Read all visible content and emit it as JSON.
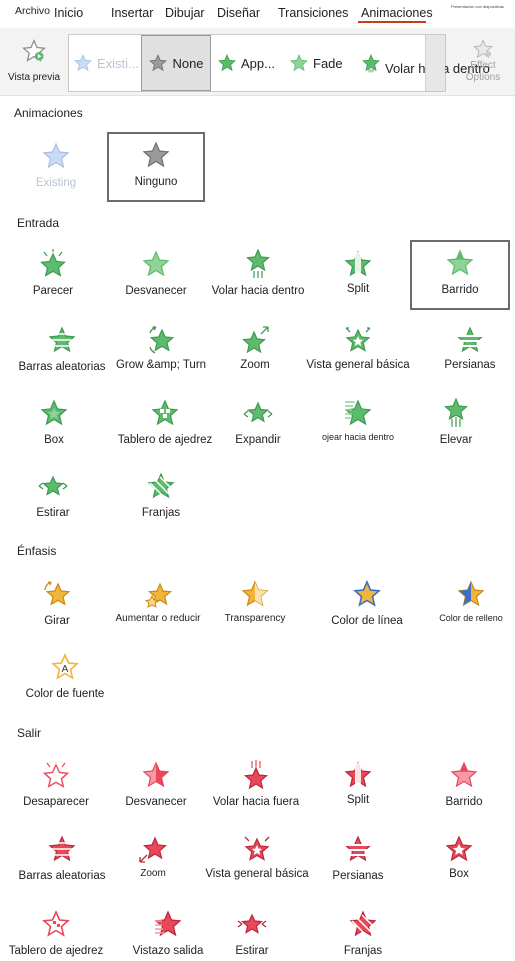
{
  "tabs": {
    "archivo": "Archivo",
    "inicio": "Inicio",
    "insertar": "Insertar",
    "dibujar": "Dibujar",
    "disenar": "Diseñar",
    "transiciones": "Transiciones",
    "animaciones": "Animaciones",
    "presentacion": "Presentación con diapositivas"
  },
  "ribbon": {
    "preview_label": "Vista previa",
    "gallery": [
      {
        "label": "Existi..."
      },
      {
        "label": "None"
      },
      {
        "label": "App..."
      },
      {
        "label": "Fade"
      },
      {
        "label": "Volar hacia dentro"
      }
    ],
    "effect_options_line1": "Effect",
    "effect_options_line2": "Options"
  },
  "sections": {
    "animaciones": {
      "title": "Animaciones",
      "items": [
        "Existing",
        "Ninguno"
      ]
    },
    "entrada": {
      "title": "Entrada",
      "items": [
        "Parecer",
        "Desvanecer",
        "Volar hacia dentro",
        "Split",
        "Barrido",
        "Barras aleatorias",
        "Grow &amp; Turn",
        "Zoom",
        "Vista general básica",
        "Persianas",
        "Box",
        "Tablero de ajedrez",
        "Expandir",
        "ojear hacia dentro",
        "Elevar",
        "Estirar",
        "Franjas"
      ]
    },
    "enfasis": {
      "title": "Énfasis",
      "items": [
        "Girar",
        "Aumentar o reducir",
        "Transparency",
        "Color de línea",
        "Color de relleno",
        "Color de fuente"
      ]
    },
    "salir": {
      "title": "Salir",
      "items": [
        "Desaparecer",
        "Desvanecer",
        "Volar hacia fuera",
        "Split",
        "Barrido",
        "Barras aleatorias",
        "Zoom",
        "Vista general básica",
        "Persianas",
        "Box",
        "Tablero de ajedrez",
        "Vistazo salida",
        "Estirar",
        "Franjas"
      ]
    }
  },
  "colors": {
    "accent_tab": "#c43e1c",
    "entrance_green": "#5dbb6e",
    "emphasis_gold": "#f2b53c",
    "exit_red": "#e8495a",
    "none_gray": "#8a8a8a"
  }
}
